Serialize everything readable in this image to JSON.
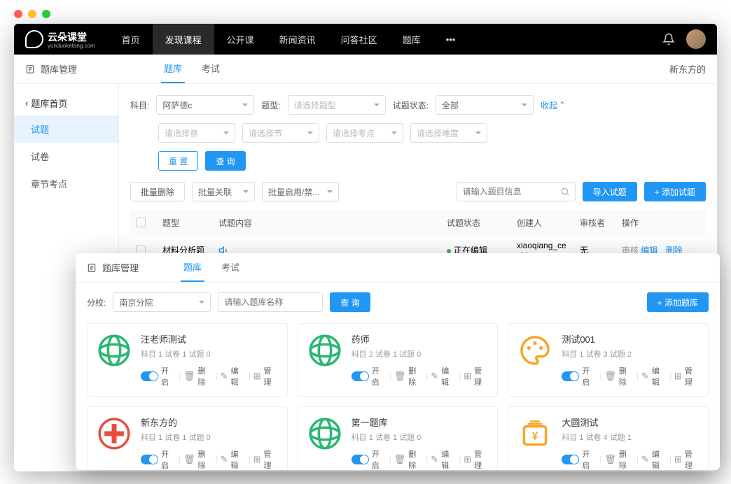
{
  "logo": {
    "main": "云朵课堂",
    "sub": "yunduoketang.com"
  },
  "nav": [
    "首页",
    "发现课程",
    "公开课",
    "新闻资讯",
    "问答社区",
    "题库",
    "•••"
  ],
  "nav_active": 1,
  "win1": {
    "header_title": "题库管理",
    "tabs": [
      "题库",
      "考试"
    ],
    "tab_active": 0,
    "header_right": "新东方的",
    "back": "题库首页",
    "side": [
      "试题",
      "试卷",
      "章节考点"
    ],
    "side_active": 0,
    "filters": {
      "subject_lbl": "科目:",
      "subject_val": "阿萨德c",
      "type_lbl": "题型:",
      "type_ph": "请选择题型",
      "status_lbl": "试题状态:",
      "status_val": "全部",
      "collapse": "收起",
      "chapter_ph": "请选择章",
      "section_ph": "请选择节",
      "point_ph": "请选择考点",
      "difficulty_ph": "请选择难度",
      "reset": "重 置",
      "query": "查 询"
    },
    "toolbar": {
      "batch_delete": "批量删除",
      "batch_link": "批量关联",
      "batch_toggle": "批量启用/禁...",
      "search_ph": "请输入题目信息",
      "import": "导入试题",
      "add": "+ 添加试题"
    },
    "table": {
      "headers": [
        "题型",
        "试题内容",
        "试题状态",
        "创建人",
        "审核者",
        "操作"
      ],
      "row": {
        "type": "材料分析题",
        "status": "正在编辑",
        "creator": "xiaoqiang_ceshi",
        "reviewer": "无",
        "ops": [
          "审核",
          "编辑",
          "删除"
        ]
      }
    }
  },
  "win2": {
    "header_title": "题库管理",
    "tabs": [
      "题库",
      "考试"
    ],
    "tab_active": 0,
    "filter": {
      "branch_lbl": "分校:",
      "branch_val": "南京分院",
      "name_ph": "请输入题库名称",
      "query": "查 询",
      "add": "+ 添加题库"
    },
    "cards": [
      {
        "title": "汪老师测试",
        "meta": "科目 1  试卷 1  试题 0",
        "icon": "globe-green"
      },
      {
        "title": "药师",
        "meta": "科目 2  试卷 1  试题 0",
        "icon": "globe-green"
      },
      {
        "title": "测试001",
        "meta": "科目 1  试卷 3  试题 2",
        "icon": "palette-orange"
      },
      {
        "title": "新东方的",
        "meta": "科目 1  试卷 1  试题 0",
        "icon": "coin-red"
      },
      {
        "title": "第一题库",
        "meta": "科目 1  试卷 1  试题 0",
        "icon": "globe-green"
      },
      {
        "title": "大圆测试",
        "meta": "科目 1  试卷 4  试题 1",
        "icon": "money-orange"
      }
    ],
    "card_ops": {
      "open": "开启",
      "delete": "删除",
      "edit": "编辑",
      "manage": "管理"
    }
  }
}
